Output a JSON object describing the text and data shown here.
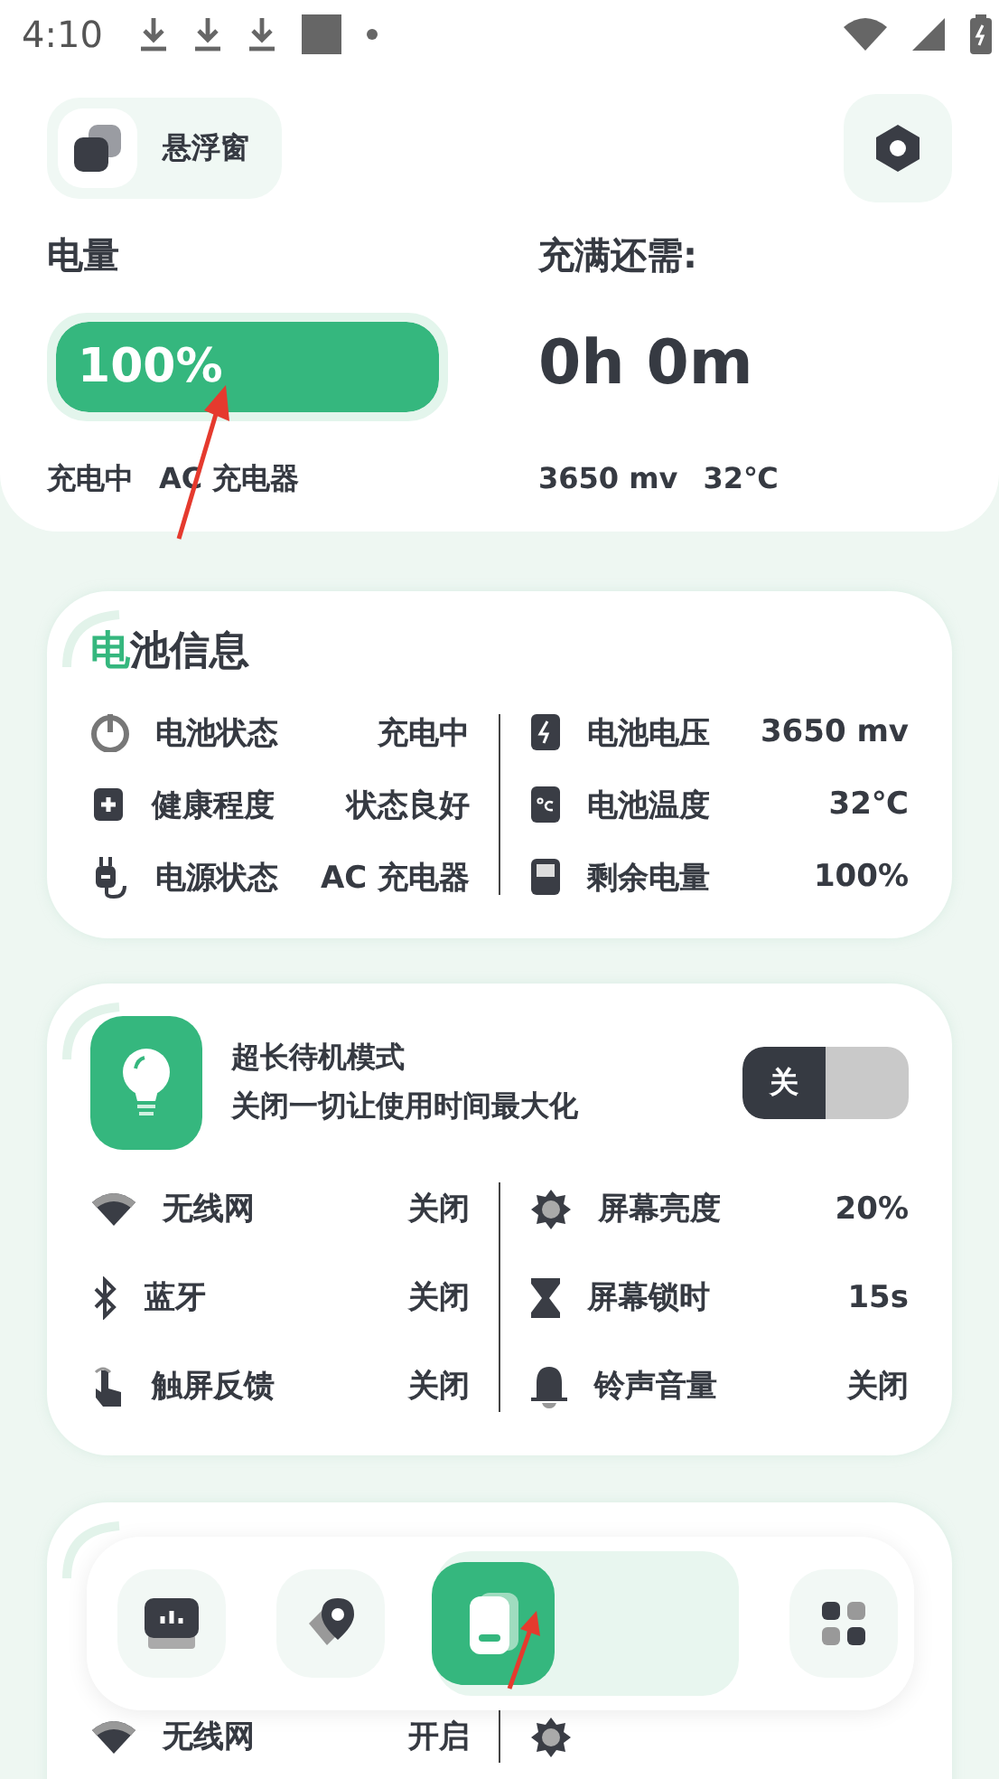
{
  "status_bar": {
    "time": "4:10"
  },
  "header": {
    "float_window": {
      "label": "悬浮窗"
    }
  },
  "battery": {
    "label": "电量",
    "level": 1,
    "reading": "100%",
    "state": "充电中",
    "source": "AC 充电器",
    "remaining_label": "充满还需:",
    "remaining": "0h 0m",
    "voltage": "3650 mv",
    "temperature": "32℃"
  },
  "battery_info": {
    "title_accent": "电",
    "title": "池信息",
    "left": [
      {
        "label": "电池状态",
        "value": "充电中"
      },
      {
        "label": "健康程度",
        "value": "状态良好"
      },
      {
        "label": "电源状态",
        "value": "AC 充电器"
      }
    ],
    "right": [
      {
        "label": "电池电压",
        "value": "3650 mv"
      },
      {
        "label": "电池温度",
        "value": "32℃"
      },
      {
        "label": "剩余电量",
        "value": "100%"
      }
    ]
  },
  "standby": {
    "title": "超长待机模式",
    "subtitle": "关闭一切让使用时间最大化",
    "toggle": {
      "label": "关",
      "on": false
    },
    "left": [
      {
        "label": "无线网",
        "value": "关闭"
      },
      {
        "label": "蓝牙",
        "value": "关闭"
      },
      {
        "label": "触屏反馈",
        "value": "关闭"
      }
    ],
    "right": [
      {
        "label": "屏幕亮度",
        "value": "20%"
      },
      {
        "label": "屏幕锁时",
        "value": "15s"
      },
      {
        "label": "铃声音量",
        "value": "关闭"
      }
    ]
  },
  "partial_card": {
    "rows": [
      {
        "label": "无线网",
        "value": "开启"
      }
    ]
  },
  "nav": [
    {
      "selected": false
    },
    {
      "selected": false
    },
    {
      "selected": true
    },
    {
      "selected": false
    }
  ]
}
